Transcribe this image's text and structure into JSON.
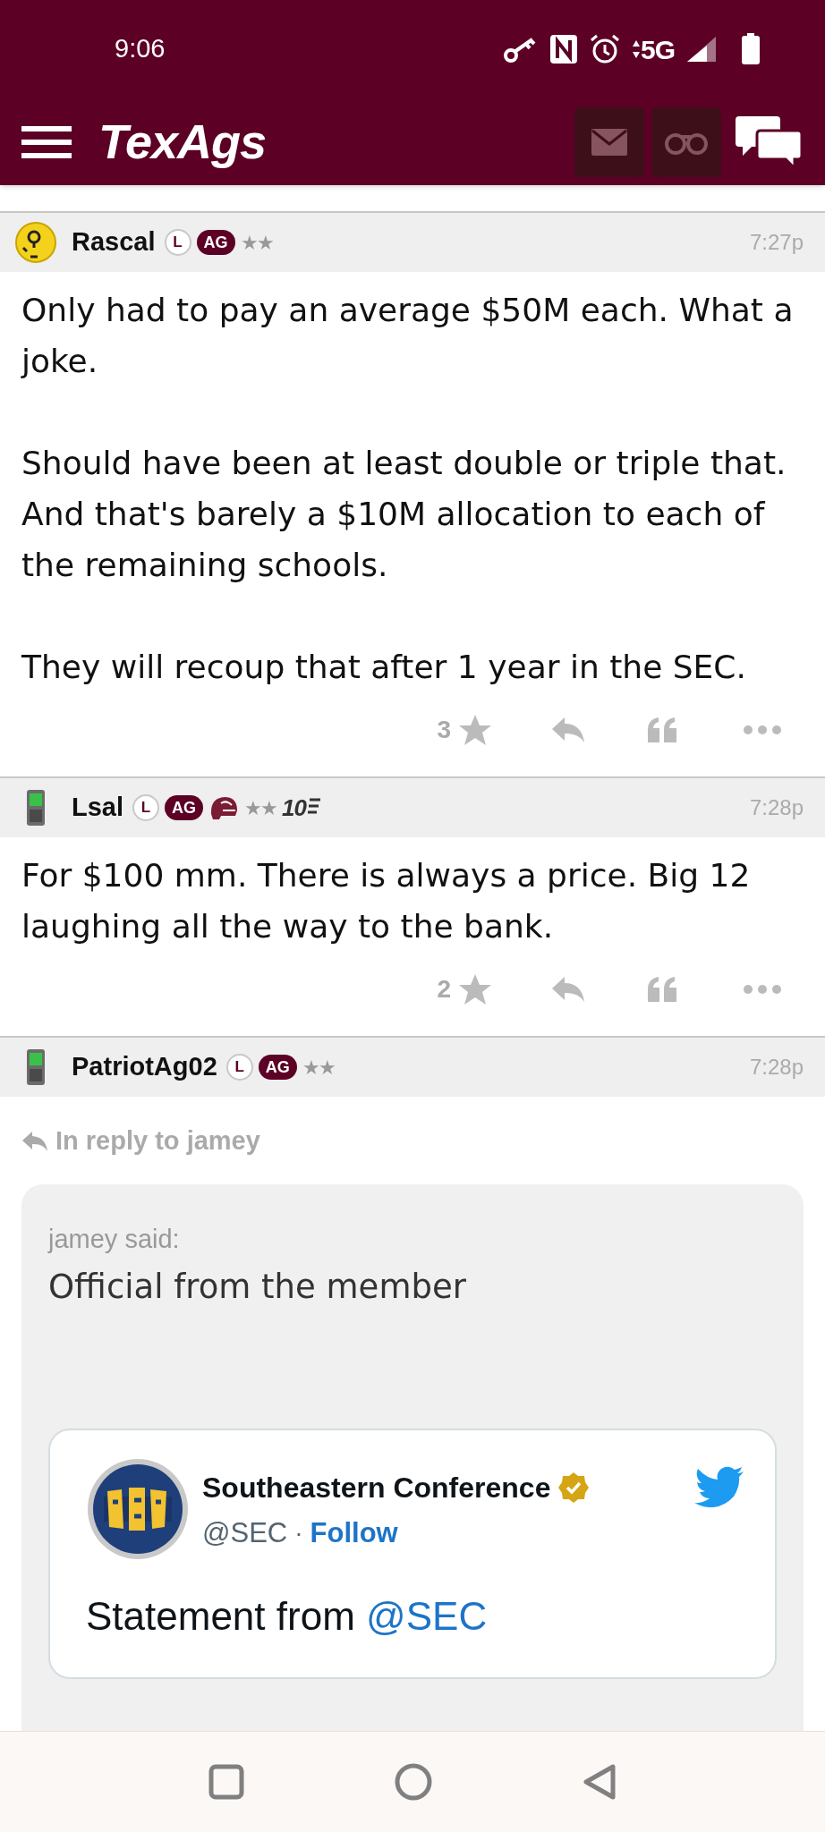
{
  "status_bar": {
    "time": "9:06",
    "network": "5G"
  },
  "app_bar": {
    "title": "TexAgs"
  },
  "posts": [
    {
      "username": "Rascal",
      "avatar": {
        "kind": "smiley"
      },
      "time": "7:27p",
      "badges": [
        {
          "kind": "circle",
          "label": "L"
        },
        {
          "kind": "pill",
          "label": "AG"
        },
        {
          "kind": "rating",
          "label": "★★"
        }
      ],
      "paragraphs": [
        "Only had to pay an average $50M each. What a joke.",
        "Should have been at least double or triple that. And that's barely a $10M allocation to each of the remaining schools.",
        "They will recoup that after 1 year in the SEC."
      ],
      "star_count": "3"
    },
    {
      "username": "Lsal",
      "avatar": {
        "kind": "phone"
      },
      "time": "7:28p",
      "badges": [
        {
          "kind": "circle",
          "label": "L"
        },
        {
          "kind": "pill",
          "label": "AG"
        },
        {
          "kind": "helmet"
        },
        {
          "kind": "rating",
          "label": "★★"
        },
        {
          "kind": "years",
          "label": "10"
        }
      ],
      "paragraphs": [
        "For $100 mm. There is always a price. Big 12 laughing all the way to the bank."
      ],
      "star_count": "2"
    },
    {
      "username": "PatriotAg02",
      "avatar": {
        "kind": "phone"
      },
      "time": "7:28p",
      "badges": [
        {
          "kind": "circle",
          "label": "L"
        },
        {
          "kind": "pill",
          "label": "AG"
        },
        {
          "kind": "rating",
          "label": "★★"
        }
      ],
      "reply_to": "In reply to jamey",
      "quote": {
        "attribution": "jamey said:",
        "text": "Official from the member",
        "tweet": {
          "name": "Southeastern Conference",
          "handle": "@SEC",
          "separator": "·",
          "follow": "Follow",
          "text": [
            {
              "text": "Statement from ",
              "link": false
            },
            {
              "text": "@SEC",
              "link": true
            }
          ]
        }
      }
    }
  ]
}
